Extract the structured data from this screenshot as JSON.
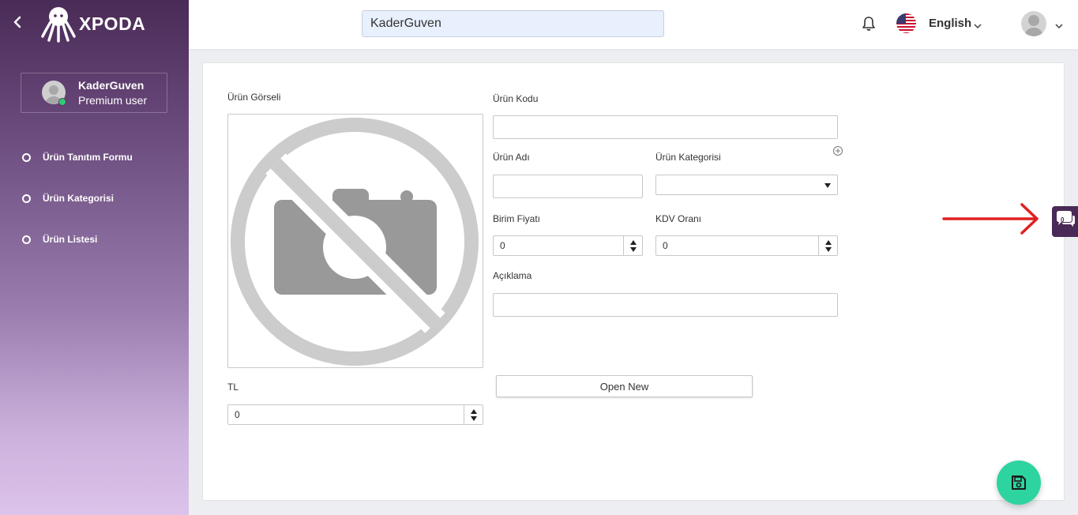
{
  "app": {
    "logo_text": "XPODA"
  },
  "user": {
    "name": "KaderGuven",
    "role": "Premium user"
  },
  "sidebar": {
    "items": [
      {
        "label": "Ürün Tanıtım Formu"
      },
      {
        "label": "Ürün Kategorisi"
      },
      {
        "label": "Ürün Listesi"
      }
    ]
  },
  "header": {
    "search_value": "KaderGuven",
    "language": "English"
  },
  "form": {
    "image_label": "Ürün Görseli",
    "code_label": "Ürün Kodu",
    "code_value": "",
    "name_label": "Ürün Adı",
    "name_value": "",
    "category_label": "Ürün Kategorisi",
    "category_value": "",
    "unit_price_label": "Birim Fiyatı",
    "unit_price_value": "0",
    "vat_label": "KDV Oranı",
    "vat_value": "0",
    "description_label": "Açıklama",
    "description_value": "",
    "currency_label": "TL",
    "currency_value": "0",
    "open_new_label": "Open New"
  },
  "chat": {
    "count": "0"
  },
  "colors": {
    "sidebar_top": "#4a2a56",
    "sidebar_bottom": "#dcc3ea",
    "save_fab": "#2dd4a0",
    "online": "#2ecc71",
    "annotation_arrow": "#e02020"
  }
}
